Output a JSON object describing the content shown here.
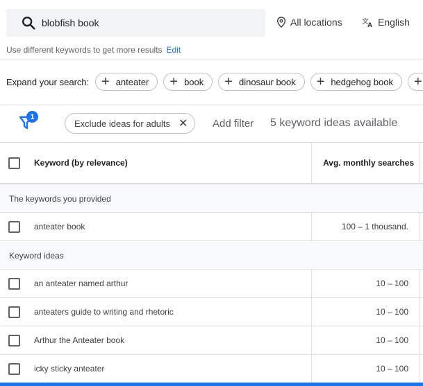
{
  "search": {
    "value": "blobfish book"
  },
  "location": {
    "label": "All locations"
  },
  "language": {
    "label": "English"
  },
  "hint": {
    "text": "Use different keywords to get more results",
    "edit_label": "Edit"
  },
  "expand": {
    "label": "Expand your search:",
    "chips": [
      "anteater",
      "book",
      "dinosaur book",
      "hedgehog book"
    ]
  },
  "filters": {
    "badge_count": "1",
    "adult_chip": "Exclude ideas for adults",
    "add_filter": "Add filter",
    "ideas_available": "5 keyword ideas available"
  },
  "table": {
    "col_keyword": "Keyword (by relevance)",
    "col_searches": "Avg. monthly searches",
    "group_provided": "The keywords you provided",
    "provided_rows": [
      {
        "keyword": "anteater book",
        "searches": "100 – 1 thousand."
      }
    ],
    "group_ideas": "Keyword ideas",
    "idea_rows": [
      {
        "keyword": "an anteater named arthur",
        "searches": "10 – 100"
      },
      {
        "keyword": "anteaters guide to writing and rhetoric",
        "searches": "10 – 100"
      },
      {
        "keyword": "Arthur the Anteater book",
        "searches": "10 – 100"
      },
      {
        "keyword": "icky sticky anteater",
        "searches": "10 – 100"
      }
    ]
  },
  "colors": {
    "accent": "#1a73e8",
    "group_bg": "#f8f9fa",
    "search_bg": "#f1f3f4"
  }
}
